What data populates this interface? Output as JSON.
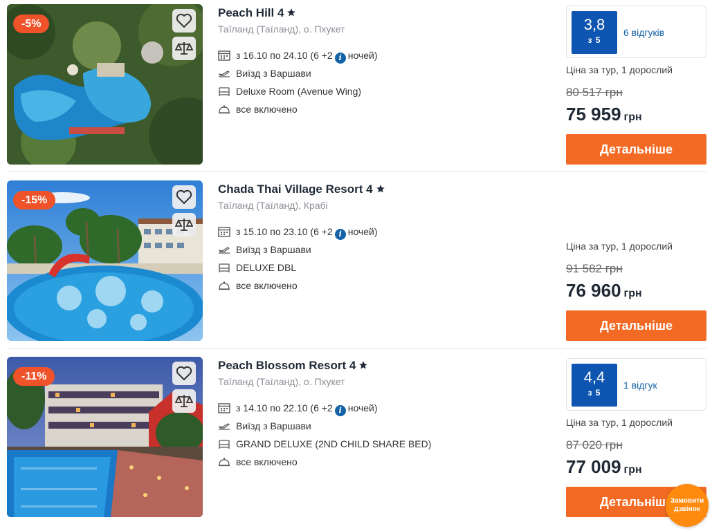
{
  "common": {
    "price_label": "Ціна за тур, 1 дорослий",
    "details_label": "Детальніше",
    "currency": "грн",
    "rating_of": "з 5"
  },
  "icons": {
    "favorite": "heart-icon",
    "compare": "scales-icon",
    "calendar": "calendar-icon",
    "flight": "plane-icon",
    "room": "bed-icon",
    "meal": "cloche-icon",
    "info": "info-icon",
    "star": "star-icon"
  },
  "colors": {
    "accent_orange": "#f26a24",
    "discount_red": "#f0522a",
    "rating_blue": "#0d55b0",
    "link_blue": "#1462a8",
    "callback_orange": "#ff8a0e"
  },
  "hotels": [
    {
      "discount": "-5%",
      "title": "Peach Hill 4",
      "location": "Таїланд (Таїланд), о. Пхукет",
      "dates": "з 16.10 по 24.10 (6 +2",
      "nights": "ночей)",
      "departure": "Виїзд з Варшави",
      "room": "Deluxe Room (Avenue Wing)",
      "meal": "все включено",
      "rating": "3,8",
      "reviews": "6 відгуків",
      "old_price": "80 517 грн",
      "price": "75 959"
    },
    {
      "discount": "-15%",
      "title": "Chada Thai Village Resort 4",
      "location": "Таїланд (Таїланд), Крабі",
      "dates": "з 15.10 по 23.10 (6 +2",
      "nights": "ночей)",
      "departure": "Виїзд з Варшави",
      "room": "DELUXE DBL",
      "meal": "все включено",
      "old_price": "91 582 грн",
      "price": "76 960"
    },
    {
      "discount": "-11%",
      "title": "Peach Blossom Resort 4",
      "location": "Таїланд (Таїланд), о. Пхукет",
      "dates": "з 14.10 по 22.10 (6 +2",
      "nights": "ночей)",
      "departure": "Виїзд з Варшави",
      "room": "GRAND DELUXE (2ND CHILD SHARE BED)",
      "meal": "все включено",
      "rating": "4,4",
      "reviews": "1 відгук",
      "old_price": "87 020 грн",
      "price": "77 009"
    }
  ],
  "callback": {
    "label": "Замовити дзвінок"
  }
}
